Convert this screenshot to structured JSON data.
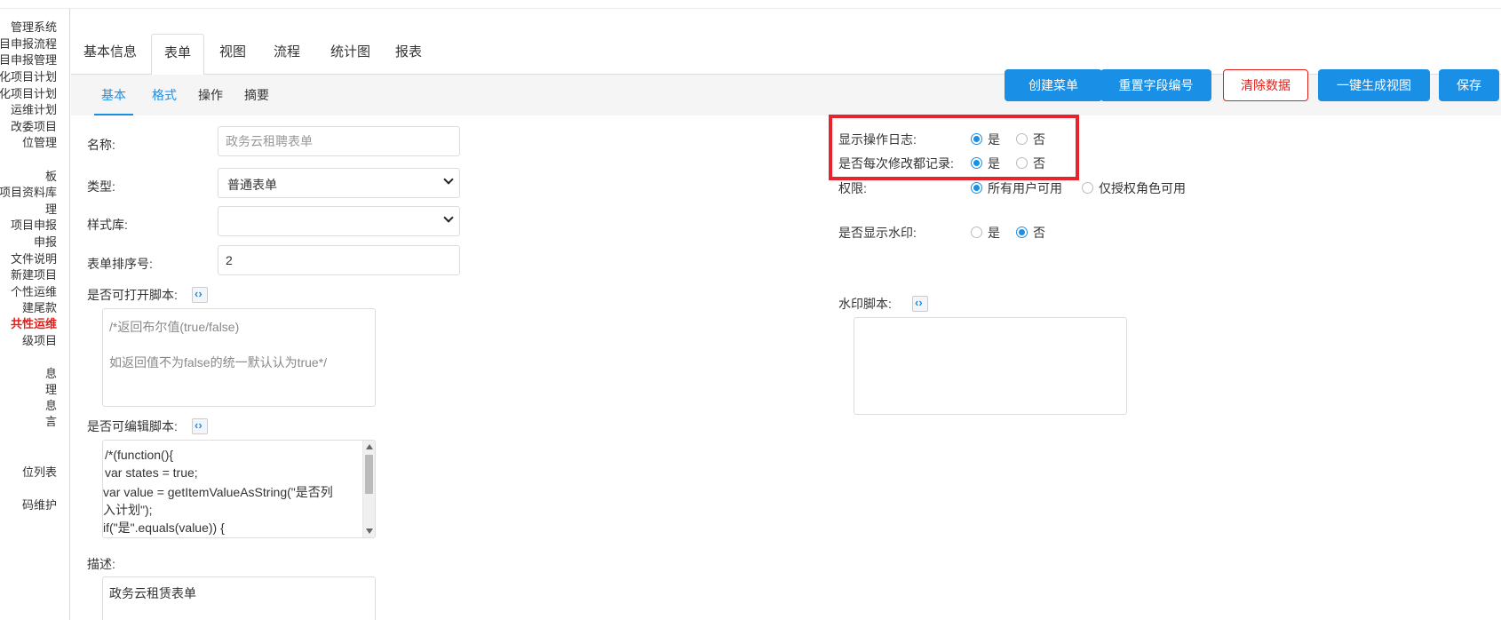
{
  "sidebar": {
    "items": [
      "管理系统",
      "项目申报流程",
      "项目申报管理",
      "息化项目计划",
      "化项目计划",
      "运维计划",
      "改委项目",
      "位管理",
      "板",
      "项目资料库",
      "理",
      "项目申报",
      "申报",
      "文件说明",
      "新建项目",
      "个性运维",
      "建尾款",
      "共性运维",
      "级项目",
      "息",
      "理",
      "息",
      "言",
      "位列表",
      "码维护"
    ]
  },
  "tabs": {
    "items": [
      "基本信息",
      "表单",
      "视图",
      "流程",
      "统计图",
      "报表"
    ],
    "active": "表单"
  },
  "subtabs": {
    "items": [
      "基本",
      "格式",
      "操作",
      "摘要"
    ],
    "active": "基本"
  },
  "actions": {
    "create_menu": "创建菜单",
    "reset_field_number": "重置字段编号",
    "clear_data": "清除数据",
    "generate_view": "一键生成视图",
    "save": "保存"
  },
  "form": {
    "name_label": "名称:",
    "name_placeholder": "政务云租聘表单",
    "type_label": "类型:",
    "type_value": "普通表单",
    "style_label": "样式库:",
    "style_value": "",
    "order_label": "表单排序号:",
    "order_value": "2",
    "open_script_label": "是否可打开脚本:",
    "open_script_lines": [
      "/*返回布尔值(true/false)",
      "",
      "如返回值不为false的统一默认认为true*/"
    ],
    "edit_script_label": "是否可编辑脚本:",
    "edit_script_lines": [
      " /*(function(){",
      " var states = true;",
      "var value = getItemValueAsString(\"是否列",
      "入计划\");",
      "if(\"是\".equals(value)) {"
    ],
    "desc_label": "描述:",
    "desc_value": "政务云租赁表单"
  },
  "options": {
    "show_log_label": "显示操作日志:",
    "record_each_label": "是否每次修改都记录:",
    "permission_label": "权限:",
    "watermark_label": "是否显示水印:",
    "watermark_script_label": "水印脚本:",
    "yes": "是",
    "no": "否",
    "perm_all": "所有用户可用",
    "perm_role": "仅授权角色可用"
  }
}
